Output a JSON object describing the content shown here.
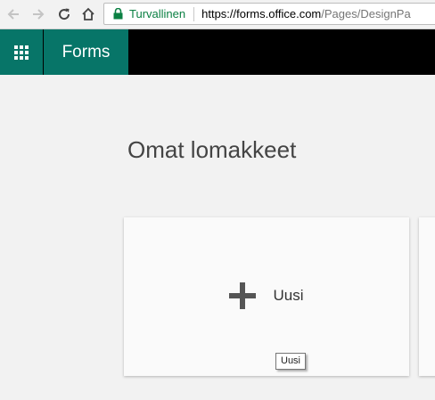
{
  "browser": {
    "secure_label": "Turvallinen",
    "url_host": "https://forms.office.com",
    "url_path": "/Pages/DesignPa"
  },
  "app": {
    "name": "Forms"
  },
  "main": {
    "title": "Omat lomakkeet",
    "new_card_label": "Uusi",
    "tooltip": "Uusi"
  },
  "colors": {
    "brand": "#077568",
    "header_bg": "#000000",
    "page_bg": "#f2f2f2",
    "secure_green": "#0b8043"
  },
  "icons": [
    "back-arrow-icon",
    "forward-arrow-icon",
    "reload-icon",
    "home-icon",
    "lock-icon",
    "app-launcher-icon",
    "plus-icon"
  ]
}
